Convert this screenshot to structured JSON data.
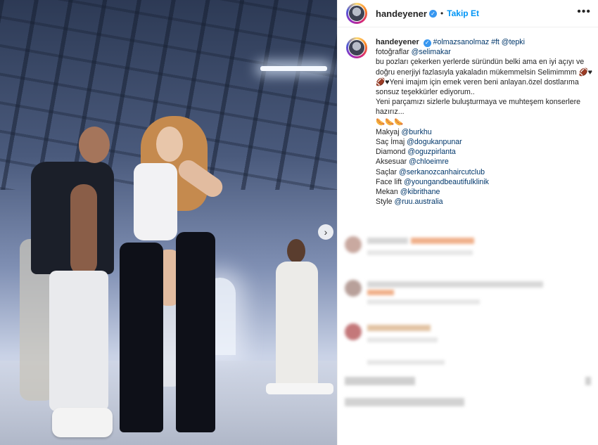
{
  "header": {
    "username": "handeyener",
    "separator": "•",
    "follow_label": "Takip Et",
    "more_label": "•••"
  },
  "caption": {
    "username": "handeyener",
    "tags_head": "#olmazsanolmaz #ft @tepki",
    "lines": [
      {
        "pre": "fotoğraflar ",
        "tag": "@selimakar"
      },
      {
        "pre": "bu pozları çekerken yerlerde süründün belki ama en iyi açıyı ve",
        "tag": ""
      },
      {
        "pre": "doğru enerjiyi fazlasıyla yakaladın mükemmelsin Selimimmm 🏈♥",
        "tag": ""
      },
      {
        "pre": "🏈♥Yeni imajım için emek veren beni anlayan.özel dostlarıma",
        "tag": ""
      },
      {
        "pre": "sonsuz teşekkürler ediyorum..",
        "tag": ""
      },
      {
        "pre": "Yeni parçamızı sizlerle buluşturmaya ve muhteşem konserlere",
        "tag": ""
      },
      {
        "pre": "hazırız...",
        "tag": ""
      },
      {
        "pre": "🌭🌭🌭",
        "tag": ""
      },
      {
        "pre": "Makyaj ",
        "tag": "@burkhu"
      },
      {
        "pre": "Saç İmaj ",
        "tag": "@dogukanpunar"
      },
      {
        "pre": "Diamond ",
        "tag": "@oguzpirlanta"
      },
      {
        "pre": "Aksesuar ",
        "tag": "@chloeimre"
      },
      {
        "pre": "Saçlar ",
        "tag": "@serkanozcanhaircutclub"
      },
      {
        "pre": "Face lift ",
        "tag": "@youngandbeautifulklinik"
      },
      {
        "pre": "Mekan ",
        "tag": "@kibrithane"
      },
      {
        "pre": "Style ",
        "tag": "@ruu.australia"
      }
    ]
  },
  "media": {
    "next_label": "›"
  },
  "colors": {
    "link": "#00376b",
    "follow": "#0095f6",
    "verified": "#3897f0"
  }
}
